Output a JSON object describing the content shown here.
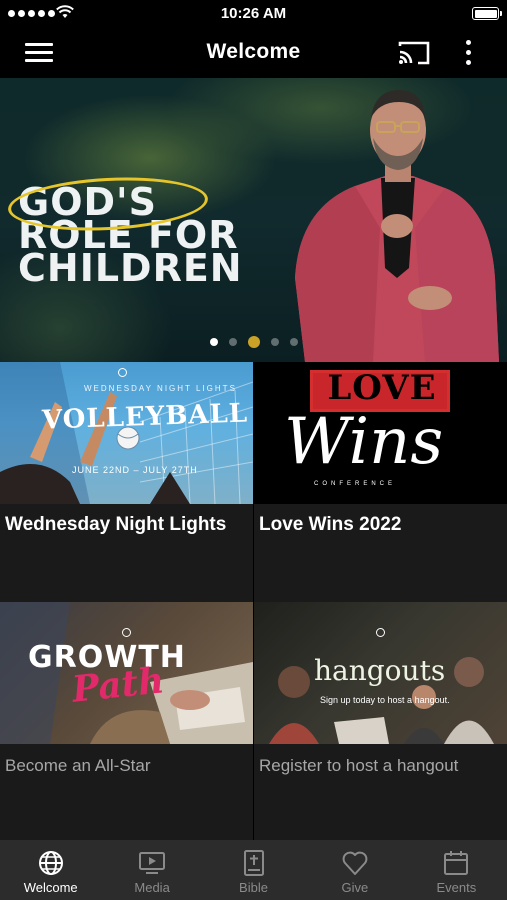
{
  "status_bar": {
    "time": "10:26 AM"
  },
  "header": {
    "title": "Welcome"
  },
  "hero": {
    "line1": "GOD'S",
    "line2": "ROLE FOR",
    "line3": "CHILDREN",
    "pagination": {
      "count": 5,
      "active_index": 0
    }
  },
  "cards": [
    {
      "title": "Wednesday Night Lights",
      "thumb_heading": "VOLLEYBALL",
      "thumb_top": "WEDNESDAY NIGHT LIGHTS",
      "thumb_dates": "JUNE 22ND – JULY 27TH"
    },
    {
      "title": "Love Wins 2022",
      "thumb_love": "LOVE",
      "thumb_wins": "Wins",
      "thumb_conf": "CONFERENCE"
    },
    {
      "subtitle": "Become an All-Star",
      "thumb_growth": "GROWTH",
      "thumb_path": "Path"
    },
    {
      "subtitle": "Register to host a hangout",
      "thumb_hangouts": "hangouts",
      "thumb_caption": "Sign up today to host a hangout."
    }
  ],
  "tabs": [
    {
      "label": "Welcome",
      "icon": "globe-icon",
      "active": true
    },
    {
      "label": "Media",
      "icon": "tv-play-icon",
      "active": false
    },
    {
      "label": "Bible",
      "icon": "bible-icon",
      "active": false
    },
    {
      "label": "Give",
      "icon": "heart-icon",
      "active": false
    },
    {
      "label": "Events",
      "icon": "calendar-icon",
      "active": false
    }
  ],
  "colors": {
    "background": "#000000",
    "tab_bar": "#2c2c2c",
    "card": "#1a1a1a",
    "active_tab": "#ffffff",
    "inactive_tab": "#8a8a8a",
    "accent_gold": "#e6c52a"
  }
}
